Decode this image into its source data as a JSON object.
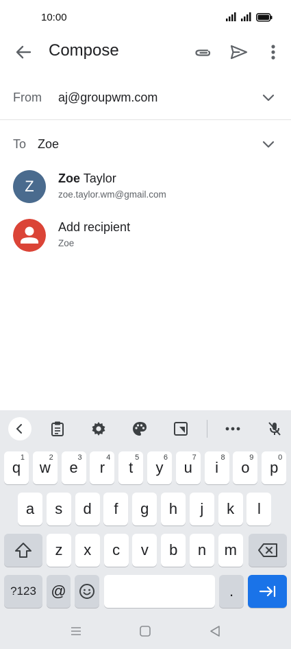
{
  "status": {
    "time": "10:00"
  },
  "appbar": {
    "title": "Compose"
  },
  "from": {
    "label": "From",
    "value": "aj@groupwm.com"
  },
  "to": {
    "label": "To",
    "value": "Zoe"
  },
  "suggestions": [
    {
      "initial": "Z",
      "name_bold": "Zoe",
      "name_rest": " Taylor",
      "email": "zoe.taylor.wm@gmail.com",
      "avatar_color": "#4a6b8e"
    },
    {
      "name": "Add recipient",
      "sub": "Zoe",
      "avatar_color": "#db4437"
    }
  ],
  "keyboard": {
    "row1": [
      {
        "k": "q",
        "n": "1"
      },
      {
        "k": "w",
        "n": "2"
      },
      {
        "k": "e",
        "n": "3"
      },
      {
        "k": "r",
        "n": "4"
      },
      {
        "k": "t",
        "n": "5"
      },
      {
        "k": "y",
        "n": "6"
      },
      {
        "k": "u",
        "n": "7"
      },
      {
        "k": "i",
        "n": "8"
      },
      {
        "k": "o",
        "n": "9"
      },
      {
        "k": "p",
        "n": "0"
      }
    ],
    "row2": [
      "a",
      "s",
      "d",
      "f",
      "g",
      "h",
      "j",
      "k",
      "l"
    ],
    "row3": [
      "z",
      "x",
      "c",
      "v",
      "b",
      "n",
      "m"
    ],
    "symbols": "?123",
    "at": "@",
    "period": "."
  },
  "colors": {
    "accent": "#1a73e8",
    "keyboard_bg": "#e8eaed"
  }
}
